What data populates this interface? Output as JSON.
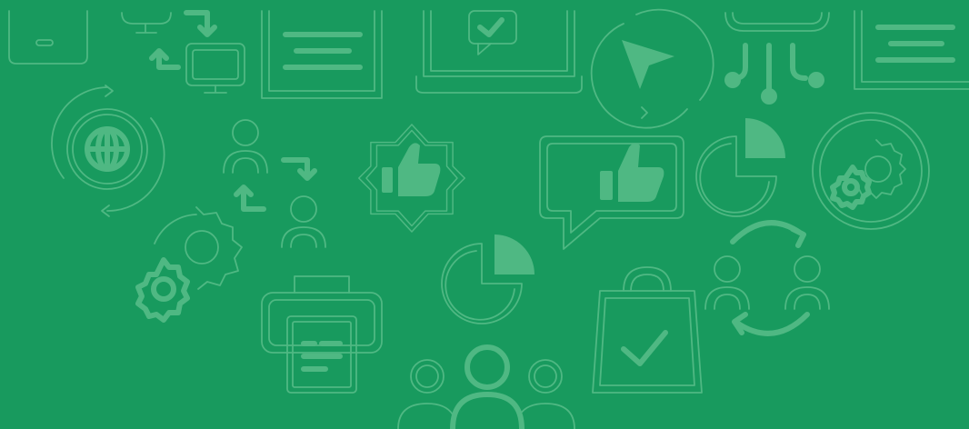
{
  "banner": {
    "background_color": "#189A5E",
    "icon_color": "#4FB883",
    "icons": [
      "tablet-icon",
      "data-transfer-icon",
      "document-frame-icon",
      "laptop-check-icon",
      "cursor-cycle-icon",
      "cloud-network-icon",
      "document-frame-icon",
      "globe-sync-icon",
      "user-swap-icon",
      "thumbs-up-badge-icon",
      "chat-like-icon",
      "pie-chart-icon",
      "gear-badge-icon",
      "gears-icon",
      "printer-icon",
      "pie-chart-icon",
      "shopping-bag-check-icon",
      "user-sync-icon",
      "team-icon"
    ]
  }
}
